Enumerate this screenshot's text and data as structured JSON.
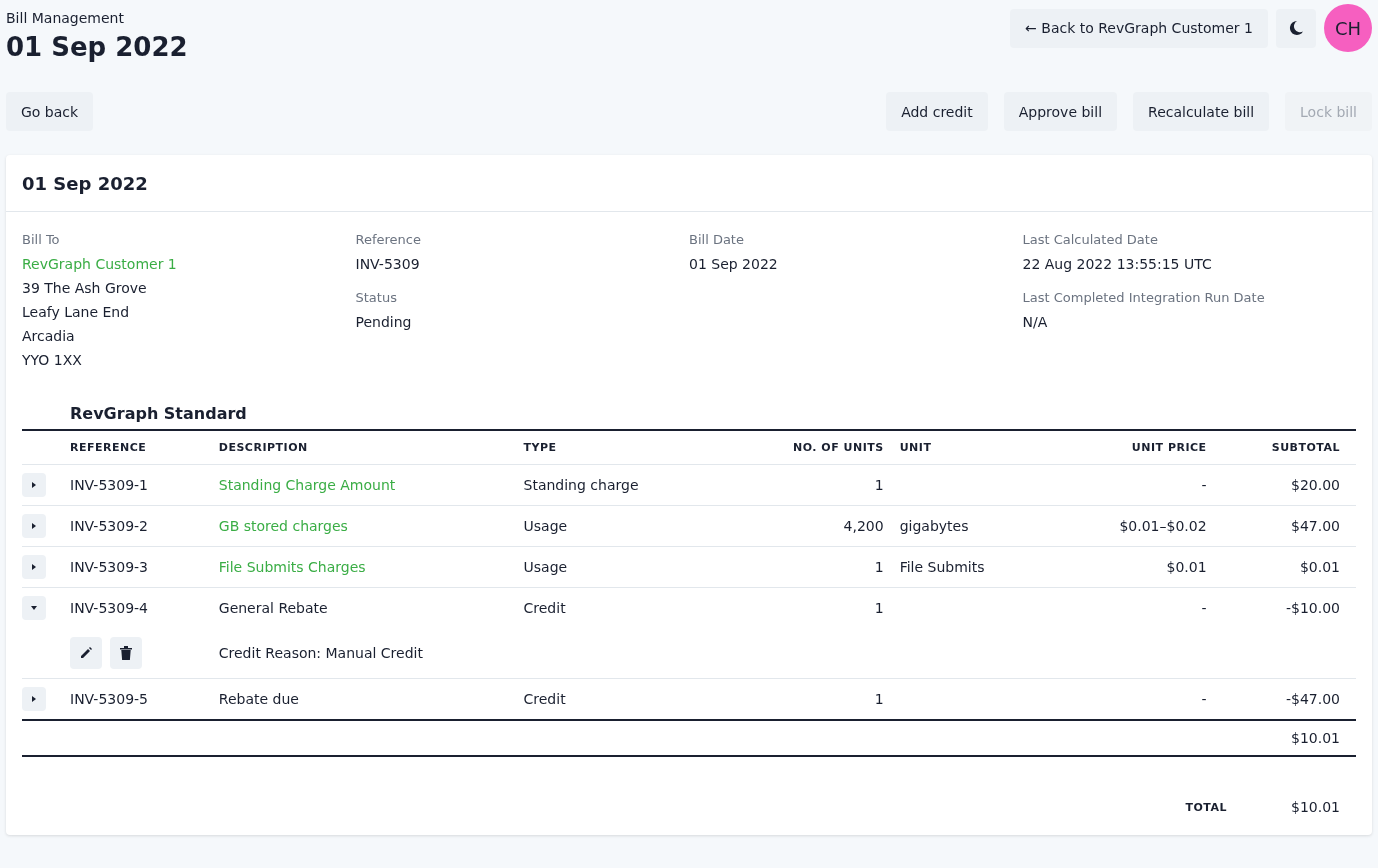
{
  "header": {
    "breadcrumb": "Bill Management",
    "title": "01 Sep 2022",
    "back_button": "← Back to RevGraph Customer 1",
    "avatar": "CH"
  },
  "actions": {
    "left": [
      {
        "label": "Go back",
        "disabled": false
      }
    ],
    "right": [
      {
        "label": "Add credit",
        "disabled": false
      },
      {
        "label": "Approve bill",
        "disabled": false
      },
      {
        "label": "Recalculate bill",
        "disabled": false
      },
      {
        "label": "Lock bill",
        "disabled": true
      }
    ]
  },
  "card": {
    "title": "01 Sep 2022",
    "details": [
      [
        {
          "label": "Bill To",
          "lines": [
            {
              "text": "RevGraph Customer 1",
              "link": true
            },
            {
              "text": "39 The Ash Grove",
              "link": false
            },
            {
              "text": "Leafy Lane End",
              "link": false
            },
            {
              "text": "Arcadia",
              "link": false
            },
            {
              "text": "YYO 1XX",
              "link": false
            }
          ]
        }
      ],
      [
        {
          "label": "Reference",
          "lines": [
            {
              "text": "INV-5309",
              "link": false
            }
          ]
        },
        {
          "label": "Status",
          "lines": [
            {
              "text": "Pending",
              "link": false
            }
          ]
        }
      ],
      [
        {
          "label": "Bill Date",
          "lines": [
            {
              "text": "01 Sep 2022",
              "link": false
            }
          ]
        }
      ],
      [
        {
          "label": "Last Calculated Date",
          "lines": [
            {
              "text": "22 Aug 2022 13:55:15 UTC",
              "link": false
            }
          ]
        },
        {
          "label": "Last Completed Integration Run Date",
          "lines": [
            {
              "text": "N/A",
              "link": false
            }
          ]
        }
      ]
    ],
    "table": {
      "title": "RevGraph Standard",
      "columns": [
        "REFERENCE",
        "DESCRIPTION",
        "TYPE",
        "NO. OF UNITS",
        "UNIT",
        "UNIT PRICE",
        "SUBTOTAL"
      ],
      "rows": [
        {
          "expanded": false,
          "reference": "INV-5309-1",
          "description": "Standing Charge Amount",
          "link": true,
          "type": "Standing charge",
          "units": "1",
          "unit": "",
          "unit_price": "-",
          "subtotal": "$20.00"
        },
        {
          "expanded": false,
          "reference": "INV-5309-2",
          "description": "GB stored charges",
          "link": true,
          "type": "Usage",
          "units": "4,200",
          "unit": "gigabytes",
          "unit_price": "$0.01–$0.02",
          "subtotal": "$47.00"
        },
        {
          "expanded": false,
          "reference": "INV-5309-3",
          "description": "File Submits Charges",
          "link": true,
          "type": "Usage",
          "units": "1",
          "unit": "File Submits",
          "unit_price": "$0.01",
          "subtotal": "$0.01"
        },
        {
          "expanded": true,
          "reference": "INV-5309-4",
          "description": "General Rebate",
          "link": false,
          "type": "Credit",
          "units": "1",
          "unit": "",
          "unit_price": "-",
          "subtotal": "-$10.00",
          "detail": "Credit Reason: Manual Credit"
        },
        {
          "expanded": false,
          "reference": "INV-5309-5",
          "description": "Rebate due",
          "link": false,
          "type": "Credit",
          "units": "1",
          "unit": "",
          "unit_price": "-",
          "subtotal": "-$47.00"
        }
      ],
      "section_total": "$10.01"
    },
    "total_label": "TOTAL",
    "total": "$10.01"
  }
}
